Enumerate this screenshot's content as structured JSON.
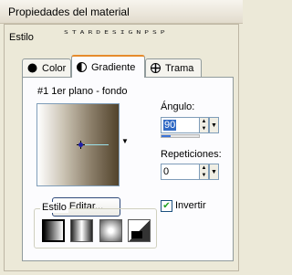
{
  "window": {
    "title": "Propiedades del material"
  },
  "estilo_top": {
    "label": "Estilo",
    "watermark": "STARDESIGNPSP"
  },
  "tabs": [
    {
      "label": "Color",
      "icon": "solid-circle-icon",
      "active": false
    },
    {
      "label": "Gradiente",
      "icon": "half-circle-icon",
      "active": true
    },
    {
      "label": "Trama",
      "icon": "pattern-icon",
      "active": false
    }
  ],
  "gradient": {
    "name": "#1 1er plano - fondo",
    "colors": [
      "#ffffff",
      "#c9c1b1",
      "#8a7d68",
      "#52432c"
    ]
  },
  "angle": {
    "label": "Ángulo:",
    "value": "90",
    "fraction": 0.25
  },
  "repeats": {
    "label": "Repeticiones:",
    "value": "0"
  },
  "edit_button": {
    "label": "Editar..."
  },
  "invert": {
    "label": "Invertir",
    "checked": true
  },
  "style_group": {
    "label": "Estilo",
    "options": [
      "linear",
      "rectangular",
      "radial",
      "sunburst"
    ],
    "selected": "linear"
  }
}
